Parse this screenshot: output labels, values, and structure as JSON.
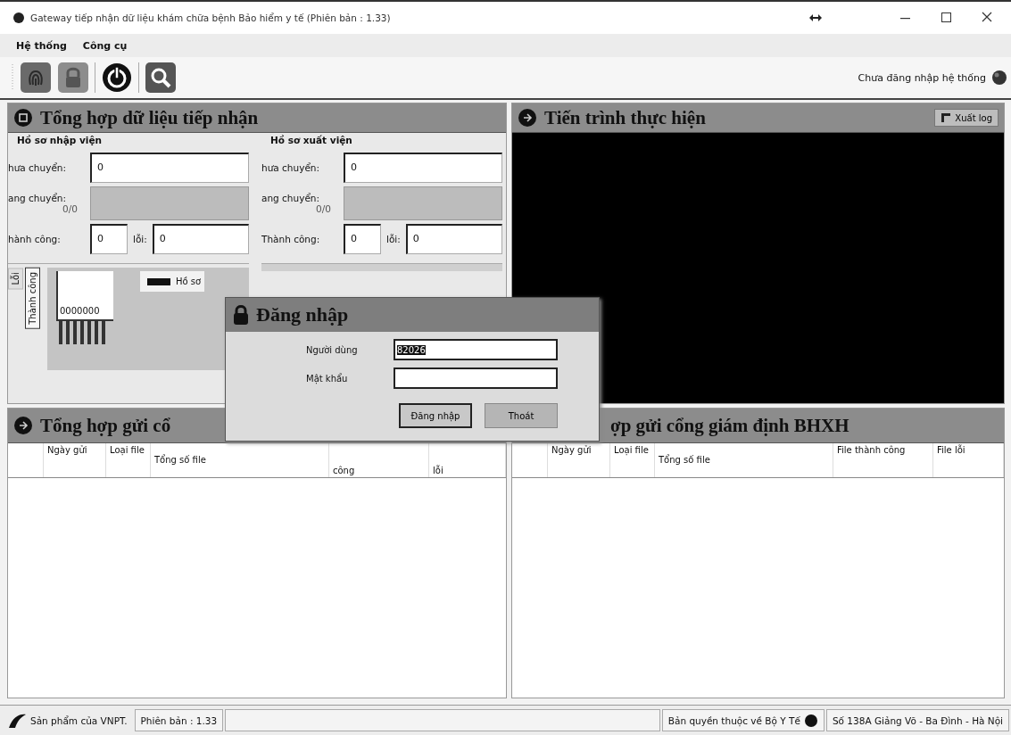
{
  "window": {
    "title": "Gateway tiếp nhận dữ liệu khám chữa bệnh Bảo hiểm y tế (Phiên bản : 1.33)"
  },
  "menu": [
    "Hệ thống",
    "Công cụ"
  ],
  "toolbar": [
    {
      "kind": "fingerprint"
    },
    {
      "kind": "lock"
    },
    {
      "kind": "power"
    },
    {
      "kind": "search"
    }
  ],
  "login_status": "Chưa đăng nhập hệ thống",
  "received_summary": {
    "title": "Tổng hợp dữ liệu tiếp nhận",
    "groups": [
      {
        "title": "Hồ sơ nhập viện",
        "pending_label": "hưa chuyển:",
        "pending_value": "0",
        "transferring_label": "ang chuyển:",
        "transferring_count": "0/0",
        "level": 0,
        "success_label": "hành công:",
        "success_value": "0",
        "error_label": "lỗi:",
        "error_value": "0"
      },
      {
        "title": "Hồ sơ xuất viện",
        "pending_label": "hưa chuyển:",
        "pending_value": "0",
        "transferring_label": "ang chuyển:",
        "transferring_count": "0/0",
        "level": 0,
        "success_label": "Thành công:",
        "success_value": "0",
        "error_label": "lỗi:",
        "error_value": "0"
      }
    ],
    "chart": {
      "tabs": [
        {
          "label": "Lỗi",
          "selected": false
        },
        {
          "label": "Thành công",
          "selected": true
        }
      ],
      "data_labels": "0000000",
      "legend": "Hồ sơ"
    }
  },
  "process_log": {
    "title": "Tiến trình thực hiện",
    "export_button": "Xuất log"
  },
  "sent_panels": [
    {
      "title": "Tổng hợp gửi cổ",
      "columns": [
        "Ngày gửi",
        "Loại file",
        "Tổng số file",
        "công",
        "lỗi"
      ]
    },
    {
      "title": "ợp gửi cổng giám định BHXH",
      "columns": [
        "Ngày gửi",
        "Loại file",
        "Tổng số file",
        "File thành công",
        "File lỗi"
      ]
    }
  ],
  "login_dialog": {
    "title": "Đăng nhập",
    "username_label": "Người dùng",
    "username": "82026",
    "password_label": "Mật khẩu",
    "buttons": [
      "Đăng nhập",
      "Thoát"
    ]
  },
  "status_bar": {
    "product": "Sản phẩm của VNPT.",
    "version": "Phiên bản : 1.33",
    "copyright": "Bản quyền thuộc về Bộ Y Tế",
    "address": "Số 138A Giảng Võ - Ba Đình - Hà Nội"
  }
}
